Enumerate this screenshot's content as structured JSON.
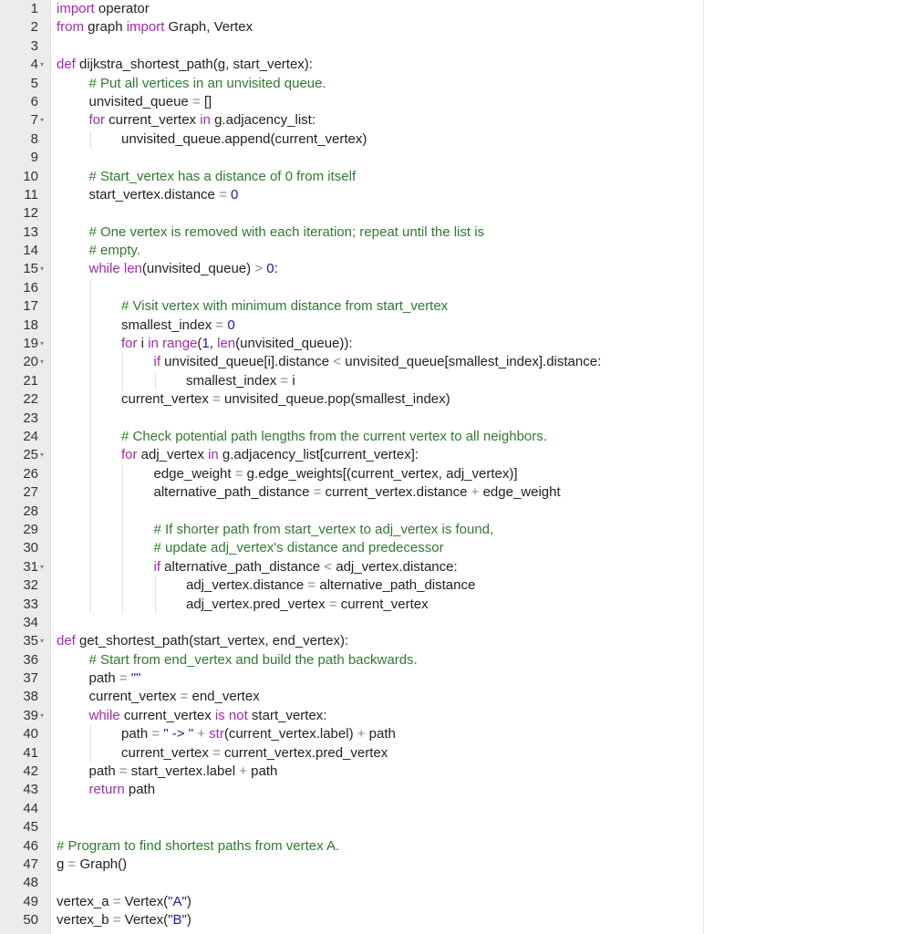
{
  "editor": {
    "lines": [
      {
        "n": "1",
        "indent": 0,
        "fold": false,
        "text": "import operator",
        "tokens": [
          [
            "kw",
            "import"
          ],
          [
            "id",
            " operator"
          ]
        ]
      },
      {
        "n": "2",
        "indent": 0,
        "fold": false,
        "text": "from graph import Graph, Vertex",
        "tokens": [
          [
            "kw",
            "from"
          ],
          [
            "id",
            " graph "
          ],
          [
            "kw",
            "import"
          ],
          [
            "id",
            " Graph, Vertex"
          ]
        ]
      },
      {
        "n": "3",
        "indent": 0,
        "fold": false,
        "text": "",
        "tokens": []
      },
      {
        "n": "4",
        "indent": 0,
        "fold": true,
        "text": "def dijkstra_shortest_path(g, start_vertex):",
        "tokens": [
          [
            "kw",
            "def"
          ],
          [
            "id",
            " dijkstra_shortest_path(g, start_vertex):"
          ]
        ]
      },
      {
        "n": "5",
        "indent": 1,
        "fold": false,
        "text": "    # Put all vertices in an unvisited queue.",
        "tokens": [
          [
            "cm",
            "# Put all vertices in an unvisited queue."
          ]
        ]
      },
      {
        "n": "6",
        "indent": 1,
        "fold": false,
        "text": "    unvisited_queue = []",
        "tokens": [
          [
            "id",
            "unvisited_queue "
          ],
          [
            "op",
            "="
          ],
          [
            "id",
            " []"
          ]
        ]
      },
      {
        "n": "7",
        "indent": 1,
        "fold": true,
        "text": "    for current_vertex in g.adjacency_list:",
        "tokens": [
          [
            "kw",
            "for"
          ],
          [
            "id",
            " current_vertex "
          ],
          [
            "kw",
            "in"
          ],
          [
            "id",
            " g.adjacency_list:"
          ]
        ]
      },
      {
        "n": "8",
        "indent": 2,
        "fold": false,
        "text": "        unvisited_queue.append(current_vertex)",
        "tokens": [
          [
            "id",
            "unvisited_queue.append(current_vertex)"
          ]
        ]
      },
      {
        "n": "9",
        "indent": 0,
        "fold": false,
        "text": "",
        "tokens": []
      },
      {
        "n": "10",
        "indent": 1,
        "fold": false,
        "text": "    # Start_vertex has a distance of 0 from itself",
        "tokens": [
          [
            "cm",
            "# Start_vertex has a distance of 0 from itself"
          ]
        ]
      },
      {
        "n": "11",
        "indent": 1,
        "fold": false,
        "text": "    start_vertex.distance = 0",
        "tokens": [
          [
            "id",
            "start_vertex.distance "
          ],
          [
            "op",
            "="
          ],
          [
            "num",
            " 0"
          ]
        ]
      },
      {
        "n": "12",
        "indent": 0,
        "fold": false,
        "text": "",
        "tokens": []
      },
      {
        "n": "13",
        "indent": 1,
        "fold": false,
        "text": "    # One vertex is removed with each iteration; repeat until the list is",
        "tokens": [
          [
            "cm",
            "# One vertex is removed with each iteration; repeat until the list is"
          ]
        ]
      },
      {
        "n": "14",
        "indent": 1,
        "fold": false,
        "text": "    # empty.",
        "tokens": [
          [
            "cm",
            "# empty."
          ]
        ]
      },
      {
        "n": "15",
        "indent": 1,
        "fold": true,
        "text": "    while len(unvisited_queue) > 0:",
        "tokens": [
          [
            "kw",
            "while"
          ],
          [
            "id",
            " "
          ],
          [
            "bi",
            "len"
          ],
          [
            "id",
            "(unvisited_queue) "
          ],
          [
            "op",
            ">"
          ],
          [
            "num",
            " 0"
          ],
          [
            "id",
            ":"
          ]
        ]
      },
      {
        "n": "16",
        "indent": 2,
        "fold": false,
        "text": "",
        "tokens": []
      },
      {
        "n": "17",
        "indent": 2,
        "fold": false,
        "text": "        # Visit vertex with minimum distance from start_vertex",
        "tokens": [
          [
            "cm",
            "# Visit vertex with minimum distance from start_vertex"
          ]
        ]
      },
      {
        "n": "18",
        "indent": 2,
        "fold": false,
        "text": "        smallest_index = 0",
        "tokens": [
          [
            "id",
            "smallest_index "
          ],
          [
            "op",
            "="
          ],
          [
            "num",
            " 0"
          ]
        ]
      },
      {
        "n": "19",
        "indent": 2,
        "fold": true,
        "text": "        for i in range(1, len(unvisited_queue)):",
        "tokens": [
          [
            "kw",
            "for"
          ],
          [
            "id",
            " i "
          ],
          [
            "kw",
            "in"
          ],
          [
            "id",
            " "
          ],
          [
            "bi",
            "range"
          ],
          [
            "id",
            "("
          ],
          [
            "num",
            "1"
          ],
          [
            "id",
            ", "
          ],
          [
            "bi",
            "len"
          ],
          [
            "id",
            "(unvisited_queue)):"
          ]
        ]
      },
      {
        "n": "20",
        "indent": 3,
        "fold": true,
        "text": "            if unvisited_queue[i].distance < unvisited_queue[smallest_index].distance:",
        "tokens": [
          [
            "kw",
            "if"
          ],
          [
            "id",
            " unvisited_queue[i].distance "
          ],
          [
            "op",
            "<"
          ],
          [
            "id",
            " unvisited_queue[smallest_index].distance:"
          ]
        ]
      },
      {
        "n": "21",
        "indent": 4,
        "fold": false,
        "text": "                smallest_index = i",
        "tokens": [
          [
            "id",
            "smallest_index "
          ],
          [
            "op",
            "="
          ],
          [
            "id",
            " i"
          ]
        ]
      },
      {
        "n": "22",
        "indent": 2,
        "fold": false,
        "text": "        current_vertex = unvisited_queue.pop(smallest_index)",
        "tokens": [
          [
            "id",
            "current_vertex "
          ],
          [
            "op",
            "="
          ],
          [
            "id",
            " unvisited_queue.pop(smallest_index)"
          ]
        ]
      },
      {
        "n": "23",
        "indent": 2,
        "fold": false,
        "text": "",
        "tokens": []
      },
      {
        "n": "24",
        "indent": 2,
        "fold": false,
        "text": "        # Check potential path lengths from the current vertex to all neighbors.",
        "tokens": [
          [
            "cm",
            "# Check potential path lengths from the current vertex to all neighbors."
          ]
        ]
      },
      {
        "n": "25",
        "indent": 2,
        "fold": true,
        "text": "        for adj_vertex in g.adjacency_list[current_vertex]:",
        "tokens": [
          [
            "kw",
            "for"
          ],
          [
            "id",
            " adj_vertex "
          ],
          [
            "kw",
            "in"
          ],
          [
            "id",
            " g.adjacency_list[current_vertex]:"
          ]
        ]
      },
      {
        "n": "26",
        "indent": 3,
        "fold": false,
        "text": "            edge_weight = g.edge_weights[(current_vertex, adj_vertex)]",
        "tokens": [
          [
            "id",
            "edge_weight "
          ],
          [
            "op",
            "="
          ],
          [
            "id",
            " g.edge_weights[(current_vertex, adj_vertex)]"
          ]
        ]
      },
      {
        "n": "27",
        "indent": 3,
        "fold": false,
        "text": "            alternative_path_distance = current_vertex.distance + edge_weight",
        "tokens": [
          [
            "id",
            "alternative_path_distance "
          ],
          [
            "op",
            "="
          ],
          [
            "id",
            " current_vertex.distance "
          ],
          [
            "op",
            "+"
          ],
          [
            "id",
            " edge_weight"
          ]
        ]
      },
      {
        "n": "28",
        "indent": 3,
        "fold": false,
        "text": "",
        "tokens": []
      },
      {
        "n": "29",
        "indent": 3,
        "fold": false,
        "text": "            # If shorter path from start_vertex to adj_vertex is found,",
        "tokens": [
          [
            "cm",
            "# If shorter path from start_vertex to adj_vertex is found,"
          ]
        ]
      },
      {
        "n": "30",
        "indent": 3,
        "fold": false,
        "text": "            # update adj_vertex's distance and predecessor",
        "tokens": [
          [
            "cm",
            "# update adj_vertex's distance and predecessor"
          ]
        ]
      },
      {
        "n": "31",
        "indent": 3,
        "fold": true,
        "text": "            if alternative_path_distance < adj_vertex.distance:",
        "tokens": [
          [
            "kw",
            "if"
          ],
          [
            "id",
            " alternative_path_distance "
          ],
          [
            "op",
            "<"
          ],
          [
            "id",
            " adj_vertex.distance:"
          ]
        ]
      },
      {
        "n": "32",
        "indent": 4,
        "fold": false,
        "text": "                adj_vertex.distance = alternative_path_distance",
        "tokens": [
          [
            "id",
            "adj_vertex.distance "
          ],
          [
            "op",
            "="
          ],
          [
            "id",
            " alternative_path_distance"
          ]
        ]
      },
      {
        "n": "33",
        "indent": 4,
        "fold": false,
        "text": "                adj_vertex.pred_vertex = current_vertex",
        "tokens": [
          [
            "id",
            "adj_vertex.pred_vertex "
          ],
          [
            "op",
            "="
          ],
          [
            "id",
            " current_vertex"
          ]
        ]
      },
      {
        "n": "34",
        "indent": 0,
        "fold": false,
        "text": "",
        "tokens": []
      },
      {
        "n": "35",
        "indent": 0,
        "fold": true,
        "text": "def get_shortest_path(start_vertex, end_vertex):",
        "tokens": [
          [
            "kw",
            "def"
          ],
          [
            "id",
            " get_shortest_path(start_vertex, end_vertex):"
          ]
        ]
      },
      {
        "n": "36",
        "indent": 1,
        "fold": false,
        "text": "    # Start from end_vertex and build the path backwards.",
        "tokens": [
          [
            "cm",
            "# Start from end_vertex and build the path backwards."
          ]
        ]
      },
      {
        "n": "37",
        "indent": 1,
        "fold": false,
        "text": "    path = \"\"",
        "tokens": [
          [
            "id",
            "path "
          ],
          [
            "op",
            "="
          ],
          [
            "str",
            " \"\""
          ]
        ]
      },
      {
        "n": "38",
        "indent": 1,
        "fold": false,
        "text": "    current_vertex = end_vertex",
        "tokens": [
          [
            "id",
            "current_vertex "
          ],
          [
            "op",
            "="
          ],
          [
            "id",
            " end_vertex"
          ]
        ]
      },
      {
        "n": "39",
        "indent": 1,
        "fold": true,
        "text": "    while current_vertex is not start_vertex:",
        "tokens": [
          [
            "kw",
            "while"
          ],
          [
            "id",
            " current_vertex "
          ],
          [
            "kw",
            "is not"
          ],
          [
            "id",
            " start_vertex:"
          ]
        ]
      },
      {
        "n": "40",
        "indent": 2,
        "fold": false,
        "text": "        path = \" -> \" + str(current_vertex.label) + path",
        "tokens": [
          [
            "id",
            "path "
          ],
          [
            "op",
            "="
          ],
          [
            "str",
            " \" -> \""
          ],
          [
            "op",
            " +"
          ],
          [
            "id",
            " "
          ],
          [
            "bi",
            "str"
          ],
          [
            "id",
            "(current_vertex.label) "
          ],
          [
            "op",
            "+"
          ],
          [
            "id",
            " path"
          ]
        ]
      },
      {
        "n": "41",
        "indent": 2,
        "fold": false,
        "text": "        current_vertex = current_vertex.pred_vertex",
        "tokens": [
          [
            "id",
            "current_vertex "
          ],
          [
            "op",
            "="
          ],
          [
            "id",
            " current_vertex.pred_vertex"
          ]
        ]
      },
      {
        "n": "42",
        "indent": 1,
        "fold": false,
        "text": "    path = start_vertex.label + path",
        "tokens": [
          [
            "id",
            "path "
          ],
          [
            "op",
            "="
          ],
          [
            "id",
            " start_vertex.label "
          ],
          [
            "op",
            "+"
          ],
          [
            "id",
            " path"
          ]
        ]
      },
      {
        "n": "43",
        "indent": 1,
        "fold": false,
        "text": "    return path",
        "tokens": [
          [
            "kw",
            "return"
          ],
          [
            "id",
            " path"
          ]
        ]
      },
      {
        "n": "44",
        "indent": 0,
        "fold": false,
        "text": "",
        "tokens": []
      },
      {
        "n": "45",
        "indent": 0,
        "fold": false,
        "text": "",
        "tokens": []
      },
      {
        "n": "46",
        "indent": 0,
        "fold": false,
        "text": "# Program to find shortest paths from vertex A.",
        "tokens": [
          [
            "cm",
            "# Program to find shortest paths from vertex A."
          ]
        ]
      },
      {
        "n": "47",
        "indent": 0,
        "fold": false,
        "text": "g = Graph()",
        "tokens": [
          [
            "id",
            "g "
          ],
          [
            "op",
            "="
          ],
          [
            "id",
            " Graph()"
          ]
        ]
      },
      {
        "n": "48",
        "indent": 0,
        "fold": false,
        "text": "",
        "tokens": []
      },
      {
        "n": "49",
        "indent": 0,
        "fold": false,
        "text": "vertex_a = Vertex(\"A\")",
        "tokens": [
          [
            "id",
            "vertex_a "
          ],
          [
            "op",
            "="
          ],
          [
            "id",
            " Vertex("
          ],
          [
            "str",
            "\"A\""
          ],
          [
            "id",
            ")"
          ]
        ]
      },
      {
        "n": "50",
        "indent": 0,
        "fold": false,
        "text": "vertex_b = Vertex(\"B\")",
        "tokens": [
          [
            "id",
            "vertex_b "
          ],
          [
            "op",
            "="
          ],
          [
            "id",
            " Vertex("
          ],
          [
            "str",
            "\"B\""
          ],
          [
            "id",
            ")"
          ]
        ]
      }
    ],
    "colors": {
      "keyword": "#a32ab0",
      "string": "#1a1aa6",
      "number": "#1a1aa6",
      "comment": "#2f7a2f",
      "text": "#222222",
      "gutter": "#ececec"
    },
    "fold_icon": "triangle-down-icon"
  }
}
